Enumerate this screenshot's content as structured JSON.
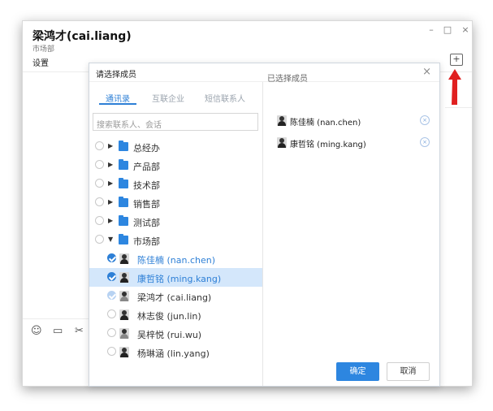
{
  "window": {
    "title": "梁鸿才(cai.liang)",
    "subtitle": "市场部",
    "settings_label": "设置",
    "controls": {
      "minimize": "–",
      "maximize": "□",
      "close": "×"
    },
    "add_button": "+"
  },
  "annotation": {
    "arrow_color": "#e02020"
  },
  "dialog": {
    "title": "请选择成员",
    "close": "×",
    "tabs": [
      "通讯录",
      "互联企业",
      "短信联系人"
    ],
    "active_tab": 0,
    "search_placeholder": "搜索联系人、会话",
    "departments": [
      {
        "name": "总经办",
        "expanded": false
      },
      {
        "name": "产品部",
        "expanded": false
      },
      {
        "name": "技术部",
        "expanded": false
      },
      {
        "name": "销售部",
        "expanded": false
      },
      {
        "name": "测试部",
        "expanded": false
      },
      {
        "name": "市场部",
        "expanded": true
      }
    ],
    "members": [
      {
        "name": "陈佳楠 (nan.chen)",
        "state": "checked",
        "highlight": false
      },
      {
        "name": "康哲铭 (ming.kang)",
        "state": "checked",
        "highlight": true
      },
      {
        "name": "梁鸿才 (cai.liang)",
        "state": "disabled-checked",
        "highlight": false
      },
      {
        "name": "林志俊 (jun.lin)",
        "state": "unchecked",
        "highlight": false
      },
      {
        "name": "吴梓悦 (rui.wu)",
        "state": "unchecked",
        "highlight": false
      },
      {
        "name": "杨琳涵 (lin.yang)",
        "state": "unchecked",
        "highlight": false
      }
    ],
    "selected_title": "已选择成员",
    "selected": [
      {
        "name": "陈佳楠 (nan.chen)"
      },
      {
        "name": "康哲铭 (ming.kang)"
      }
    ],
    "confirm": "确定",
    "cancel": "取消"
  },
  "colors": {
    "accent": "#2d86e0",
    "selected_row": "#d4e7fb"
  }
}
